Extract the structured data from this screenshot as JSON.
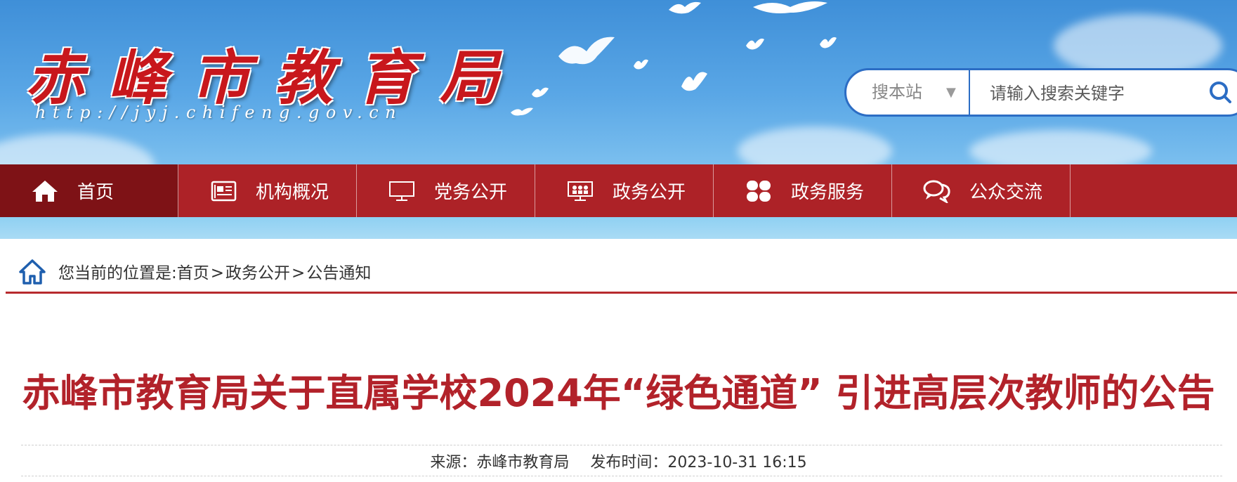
{
  "site": {
    "logo_title": "赤峰市教育局",
    "logo_url": "http://jyj.chifeng.gov.cn"
  },
  "search": {
    "scope": "搜本站",
    "placeholder": "请输入搜索关键字",
    "button_icon": "search-icon"
  },
  "nav": {
    "items": [
      {
        "label": "首页",
        "icon": "home-icon"
      },
      {
        "label": "机构概况",
        "icon": "newspaper-icon"
      },
      {
        "label": "党务公开",
        "icon": "monitor-icon"
      },
      {
        "label": "政务公开",
        "icon": "presentation-icon"
      },
      {
        "label": "政务服务",
        "icon": "grid-icon"
      },
      {
        "label": "公众交流",
        "icon": "chat-icon"
      }
    ],
    "active_index": 0
  },
  "breadcrumb": {
    "prefix": "您当前的位置是:",
    "items": [
      "首页",
      "政务公开",
      "公告通知"
    ],
    "separator": ">"
  },
  "article": {
    "title": "赤峰市教育局关于直属学校2024年“绿色通道” 引进高层次教师的公告",
    "source_label": "来源：",
    "source": "赤峰市教育局",
    "date_label": "发布时间：",
    "date": "2023-10-31 16:15"
  },
  "colors": {
    "nav_bg": "#ad2227",
    "nav_active": "#7e1216",
    "title_red": "#b2222a",
    "search_border": "#2c6dc4"
  }
}
